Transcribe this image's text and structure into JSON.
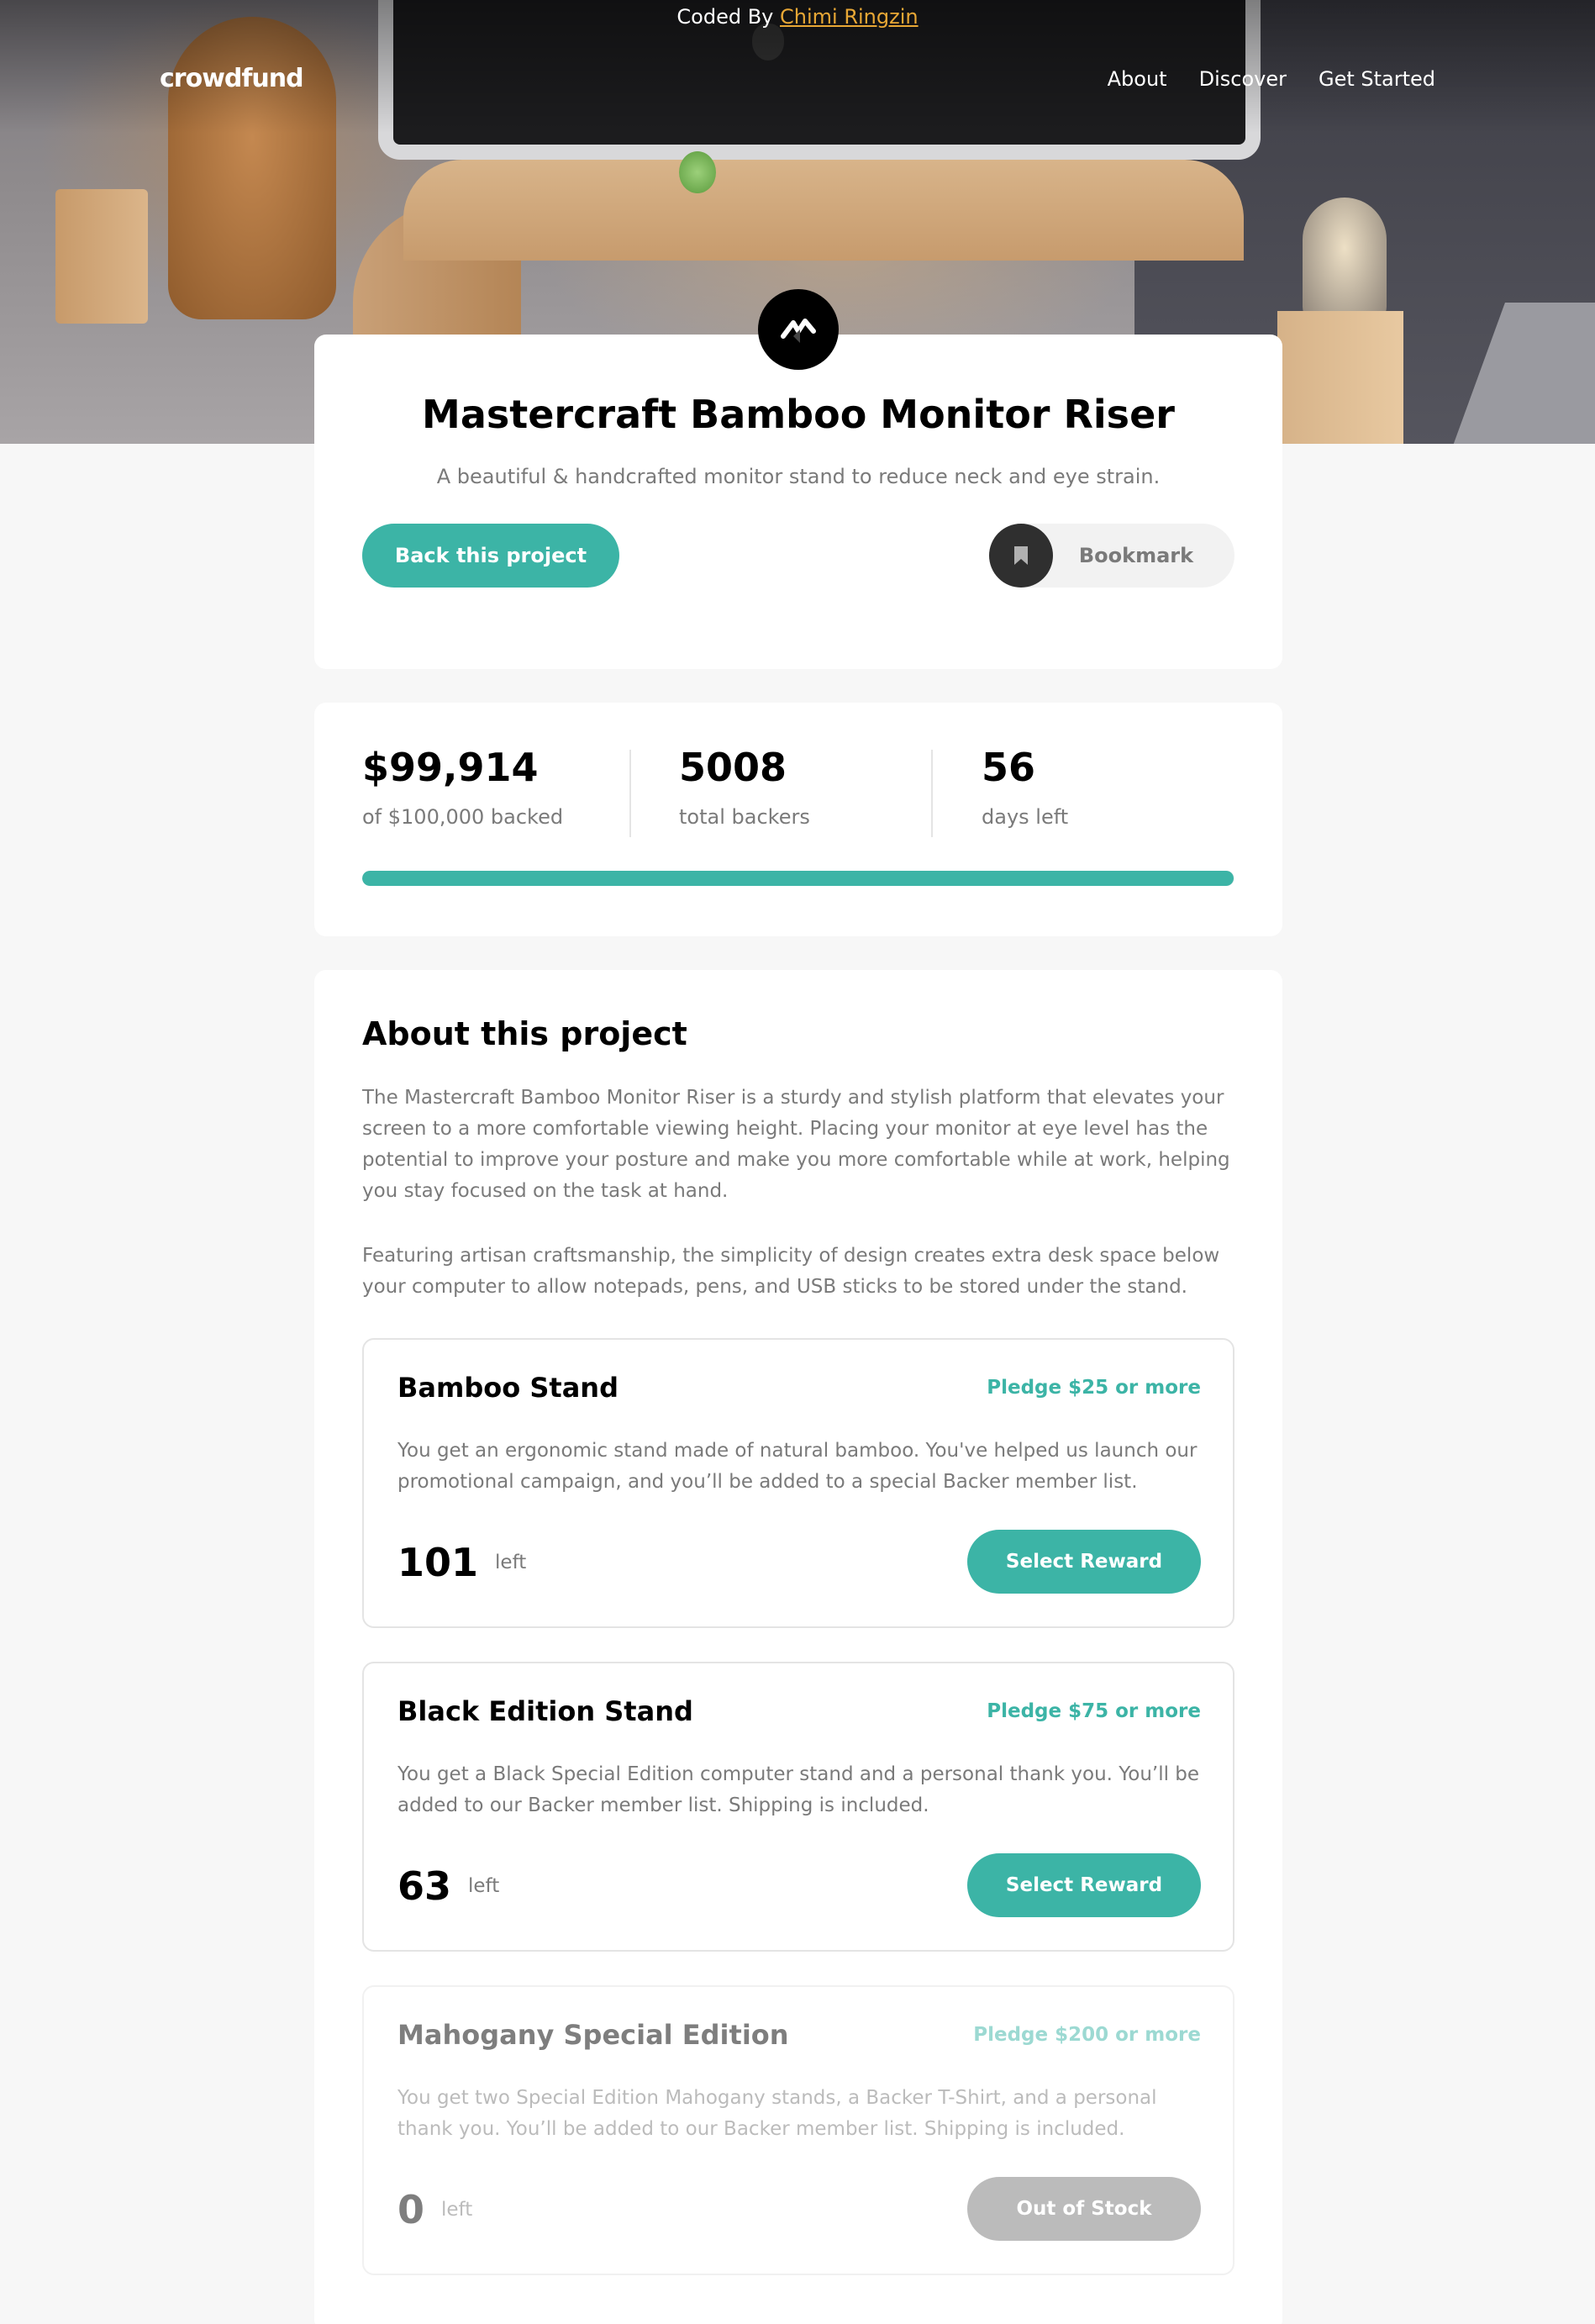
{
  "attribution": {
    "prefix": "Coded By",
    "author": "Chimi Ringzin"
  },
  "header": {
    "logo": "crowdfund",
    "nav": [
      "About",
      "Discover",
      "Get Started"
    ]
  },
  "project": {
    "title": "Mastercraft Bamboo Monitor Riser",
    "subtitle": "A beautiful & handcrafted monitor stand to reduce neck and eye strain.",
    "back_label": "Back this project",
    "bookmark_label": "Bookmark"
  },
  "stats": {
    "backed_amount": "$99,914",
    "backed_label": "of $100,000 backed",
    "backers_count": "5008",
    "backers_label": "total backers",
    "days_count": "56",
    "days_label": "days left",
    "progress_percent": 99.9
  },
  "about": {
    "heading": "About this project",
    "paragraphs": [
      "The Mastercraft Bamboo Monitor Riser is a sturdy and stylish platform that elevates your screen to a more comfortable viewing height. Placing your monitor at eye level has the potential to improve your posture and make you more comfortable while at work, helping you stay focused on the task at hand.",
      "Featuring artisan craftsmanship, the simplicity of design creates extra desk space below your computer to allow notepads, pens, and USB sticks to be stored under the stand."
    ]
  },
  "rewards": [
    {
      "name": "Bamboo Stand",
      "pledge": "Pledge $25 or more",
      "description": "You get an ergonomic stand made of natural bamboo. You've helped us launch our promotional campaign, and you’ll be added to a special Backer member list.",
      "left_count": "101",
      "left_label": "left",
      "button": "Select Reward"
    },
    {
      "name": "Black Edition Stand",
      "pledge": "Pledge $75 or more",
      "description": "You get a Black Special Edition computer stand and a personal thank you. You’ll be added to our Backer member list. Shipping is included.",
      "left_count": "63",
      "left_label": "left",
      "button": "Select Reward"
    },
    {
      "name": "Mahogany Special Edition",
      "pledge": "Pledge $200 or more",
      "description": "You get two Special Edition Mahogany stands, a Backer T-Shirt, and a personal thank you. You’ll be added to our Backer member list. Shipping is included.",
      "left_count": "0",
      "left_label": "left",
      "button": "Out of Stock"
    }
  ],
  "colors": {
    "accent": "#3cb4a6",
    "muted": "#7a7a7a",
    "link": "#e8a735"
  },
  "icons": [
    "mastercraft-logo-icon",
    "bookmark-icon"
  ]
}
